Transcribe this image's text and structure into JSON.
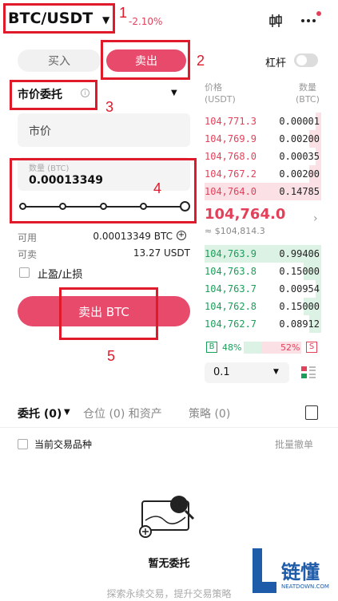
{
  "header": {
    "pair": "BTC/USDT",
    "change": "-2.10%",
    "icons": [
      "candlestick-icon",
      "more-icon"
    ]
  },
  "trade": {
    "tabs": {
      "buy": "买入",
      "sell": "卖出"
    },
    "leverage_label": "杠杆",
    "leverage_on": false,
    "order_type": "市价委托",
    "price_field": "市价",
    "qty_label": "数量 (BTC)",
    "qty_value": "0.00013349",
    "slider_percent": 100,
    "available_label": "可用",
    "available_value": "0.00013349 BTC",
    "sellable_label": "可卖",
    "sellable_value": "13.27 USDT",
    "tpsl_label": "止盈/止损",
    "submit_label": "卖出 BTC"
  },
  "orderbook": {
    "price_header": "价格",
    "price_unit": "(USDT)",
    "qty_header": "数量",
    "qty_unit": "(BTC)",
    "asks": [
      {
        "price": "104,771.3",
        "qty": "0.00001",
        "depth": 0.05
      },
      {
        "price": "104,769.9",
        "qty": "0.00200",
        "depth": 0.1
      },
      {
        "price": "104,768.0",
        "qty": "0.00035",
        "depth": 0.05
      },
      {
        "price": "104,767.2",
        "qty": "0.00200",
        "depth": 0.1
      },
      {
        "price": "104,764.0",
        "qty": "0.14785",
        "depth": 1.0
      }
    ],
    "last_price": "104,764.0",
    "last_price_usd": "≈ $104,814.3",
    "bids": [
      {
        "price": "104,763.9",
        "qty": "0.99406",
        "depth": 1.0
      },
      {
        "price": "104,763.8",
        "qty": "0.15000",
        "depth": 0.15
      },
      {
        "price": "104,763.7",
        "qty": "0.00954",
        "depth": 0.05
      },
      {
        "price": "104,762.8",
        "qty": "0.15000",
        "depth": 0.15
      },
      {
        "price": "104,762.7",
        "qty": "0.08912",
        "depth": 0.1
      }
    ],
    "buy_badge": "B",
    "buy_ratio": "48%",
    "sell_ratio": "52%",
    "sell_badge": "S",
    "depth_step": "0.1"
  },
  "bottom": {
    "tabs": [
      "委托 (0)",
      "仓位 (0) 和资产",
      "策略 (0)"
    ],
    "current_symbol_label": "当前交易品种",
    "batch_cancel": "批量撤单",
    "empty_title": "暂无委托",
    "empty_sub": "探索永续交易，提升交易策略"
  },
  "annotations": [
    "1",
    "2",
    "3",
    "4",
    "5"
  ],
  "watermark": {
    "text": "链懂",
    "url": "NEATDOWN.COM"
  },
  "colors": {
    "accent_sell": "#e84a6b",
    "ask": "#e3405a",
    "bid": "#1a9e5a",
    "annotation": "#e0192b"
  }
}
